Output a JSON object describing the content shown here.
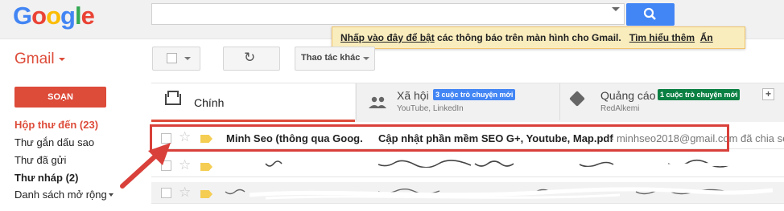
{
  "logo": {
    "letters": [
      "G",
      "o",
      "o",
      "g",
      "l",
      "e"
    ]
  },
  "search": {
    "value": "",
    "button_icon": "search-icon"
  },
  "notification": {
    "link_text": "Nhấp vào đây để bật",
    "text": " các thông báo trên màn hình cho Gmail.",
    "learn_more": "Tìm hiểu thêm",
    "hide": "Ẩn"
  },
  "app": {
    "name": "Gmail"
  },
  "toolbar": {
    "more_label": "Thao tác khác",
    "refresh_icon": "refresh-icon"
  },
  "sidebar": {
    "compose": "SOẠN",
    "items": [
      {
        "label": "Hộp thư đến (23)"
      },
      {
        "label": "Thư gắn dấu sao"
      },
      {
        "label": "Thư đã gửi"
      },
      {
        "label": "Thư nháp (2)"
      },
      {
        "label": "Danh sách mở rộng"
      }
    ]
  },
  "tabs": [
    {
      "label": "Chính",
      "icon": "inbox-icon"
    },
    {
      "label": "Xã hội",
      "badge": "3 cuộc trò chuyện mới",
      "sub": "YouTube, LinkedIn",
      "icon": "people-icon",
      "badge_color": "#4285f4"
    },
    {
      "label": "Quảng cáo",
      "badge": "1 cuộc trò chuyện mới",
      "sub": "RedAlkemi",
      "icon": "tag-icon",
      "badge_color": "#0b8043"
    }
  ],
  "messages": [
    {
      "sender": "Minh Seo (thông qua Goog.",
      "subject": "Cập nhật phần mềm SEO G+, Youtube, Map.pdf",
      "snippet": "- minhseo2018@gmail.com đã chia sẻ"
    }
  ],
  "colors": {
    "accent": "#dd4b39",
    "highlight": "#d9403a",
    "search_blue": "#4285f4"
  }
}
